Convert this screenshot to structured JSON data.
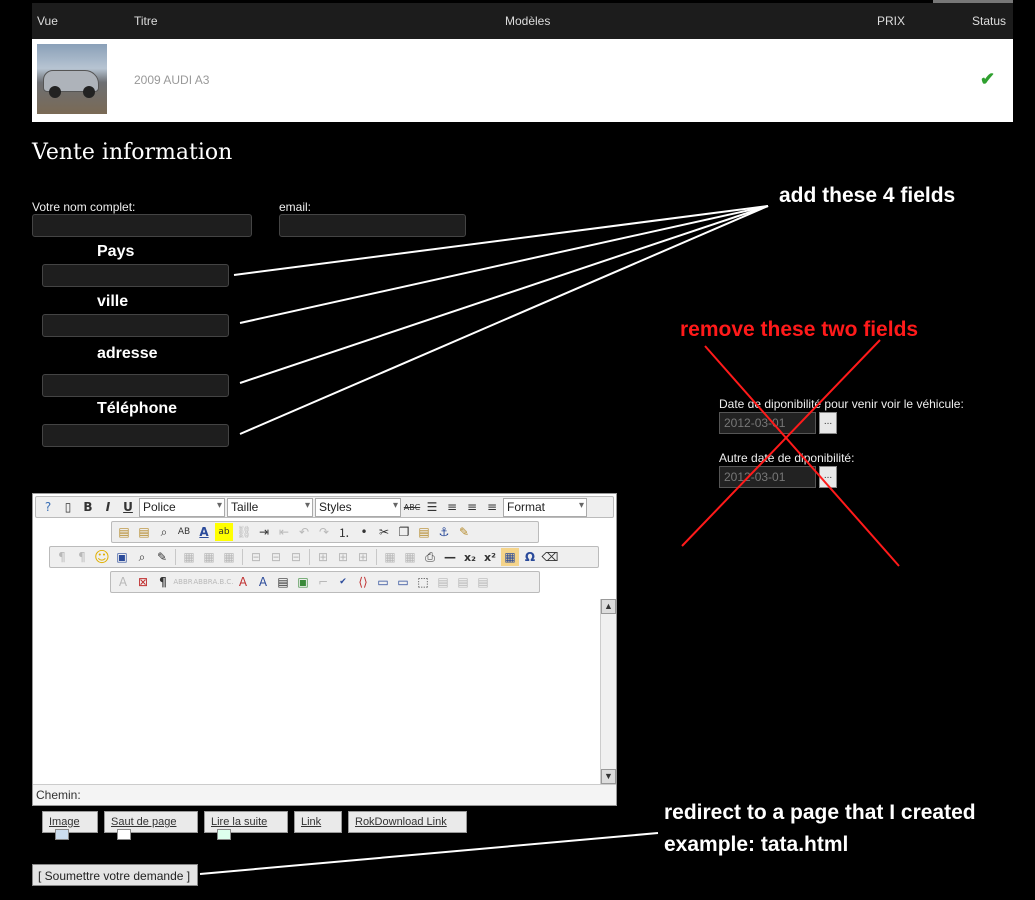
{
  "table": {
    "headers": {
      "vue": "Vue",
      "titre": "Titre",
      "modeles": "Modèles",
      "prix": "PRIX",
      "status": "Status"
    },
    "row": {
      "title": "2009 AUDI A3",
      "status_icon": "check-icon"
    }
  },
  "section_title": "Vente information",
  "form": {
    "fullname_label": "Votre nom complet:",
    "email_label": "email:",
    "pays_label": "Pays",
    "ville_label": "ville",
    "adresse_label": "adresse",
    "telephone_label": "Téléphone",
    "date1_label": "Date de diponibilité pour venir voir le véhicule:",
    "date1_value": "2012-03-01",
    "date2_label": "Autre date de diponibilité:",
    "date2_value": "2012-03-01",
    "date_button": "..."
  },
  "annotations": {
    "add_fields": "add these 4 fields",
    "remove_fields": "remove these two fields",
    "redirect_line1": "redirect to a page that I created",
    "redirect_line2": "example: tata.html"
  },
  "editor": {
    "font_select": "Police",
    "size_select": "Taille",
    "styles_select": "Styles",
    "format_select": "Format",
    "path_label": "Chemin:"
  },
  "editor_buttons": {
    "image": "Image",
    "page_break": "Saut de page",
    "read_more": "Lire la suite",
    "link": "Link",
    "rokdownload": "RokDownload Link"
  },
  "submit_label": "[ Soumettre votre demande ]",
  "colors": {
    "annotation_red": "#ff1a1a",
    "check_green": "#2fa02f"
  }
}
